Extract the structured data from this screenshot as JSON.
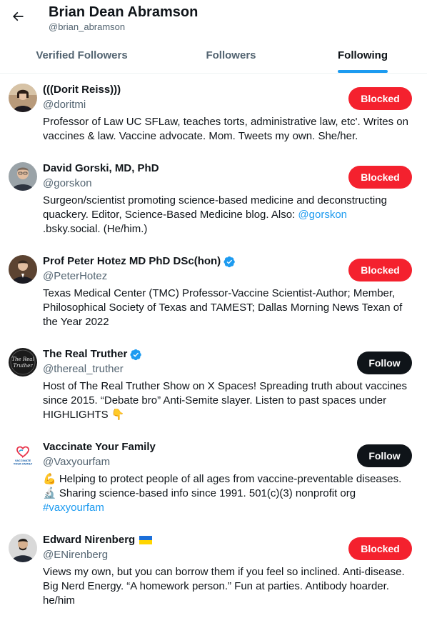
{
  "header": {
    "title": "Brian Dean Abramson",
    "handle": "@brian_abramson"
  },
  "tabs": [
    {
      "label": "Verified Followers"
    },
    {
      "label": "Followers"
    },
    {
      "label": "Following",
      "active": true
    }
  ],
  "users": [
    {
      "name": "(((Dorit Reiss)))",
      "handle": "@doritmi",
      "button": "Blocked",
      "bio": [
        "Professor of Law UC SFLaw, teaches torts, administrative law, etc'. Writes on vaccines & law. Vaccine advocate. Mom. Tweets my own. She/her."
      ]
    },
    {
      "name": "David Gorski, MD, PhD",
      "handle": "@gorskon",
      "button": "Blocked",
      "bio_parts": {
        "before": "Surgeon/scientist promoting science-based medicine and deconstructing quackery. Editor, Science-Based Medicine blog. Also: ",
        "link": "@gorskon",
        "after": ".bsky.social. (He/him.)"
      }
    },
    {
      "name": "Prof Peter Hotez MD PhD DSc(hon)",
      "handle": "@PeterHotez",
      "button": "Blocked",
      "verified": true,
      "bio": [
        "Texas Medical Center (TMC) Professor-Vaccine Scientist-Author; Member, Philosophical Society of Texas and TAMEST; Dallas Morning News Texan of the Year 2022"
      ]
    },
    {
      "name": "The Real Truther",
      "handle": "@thereal_truther",
      "button": "Follow",
      "verified": true,
      "avatar_text": "The Real Truther",
      "bio": [
        "Host of The Real Truther Show on X Spaces! Spreading truth about vaccines since 2015. “Debate bro” Anti-Semite slayer. Listen to past spaces under HIGHLIGHTS 👇"
      ]
    },
    {
      "name": "Vaccinate Your Family",
      "handle": "@Vaxyourfam",
      "button": "Follow",
      "avatar_text": "VACCINATE YOUR FAMILY",
      "bio_parts": {
        "before": "💪 Helping to protect people of all ages from vaccine-preventable diseases. 🔬 Sharing science-based info since 1991. 501(c)(3) nonprofit org ",
        "link": "#vaxyourfam",
        "after": ""
      }
    },
    {
      "name": "Edward Nirenberg",
      "handle": "@ENirenberg",
      "button": "Blocked",
      "flag": "ukraine-flag",
      "bio": [
        "Views my own, but you can borrow them if you feel so inclined. Anti-disease. Big Nerd Energy. “A homework person.” Fun at parties. Antibody hoarder. he/him"
      ]
    }
  ],
  "colors": {
    "accent": "#1d9bf0",
    "blocked": "#f4212e",
    "follow": "#0f1419",
    "secondary_text": "#536471"
  },
  "icons": [
    "back-arrow-icon",
    "verified-badge-icon",
    "ukraine-flag-icon"
  ]
}
